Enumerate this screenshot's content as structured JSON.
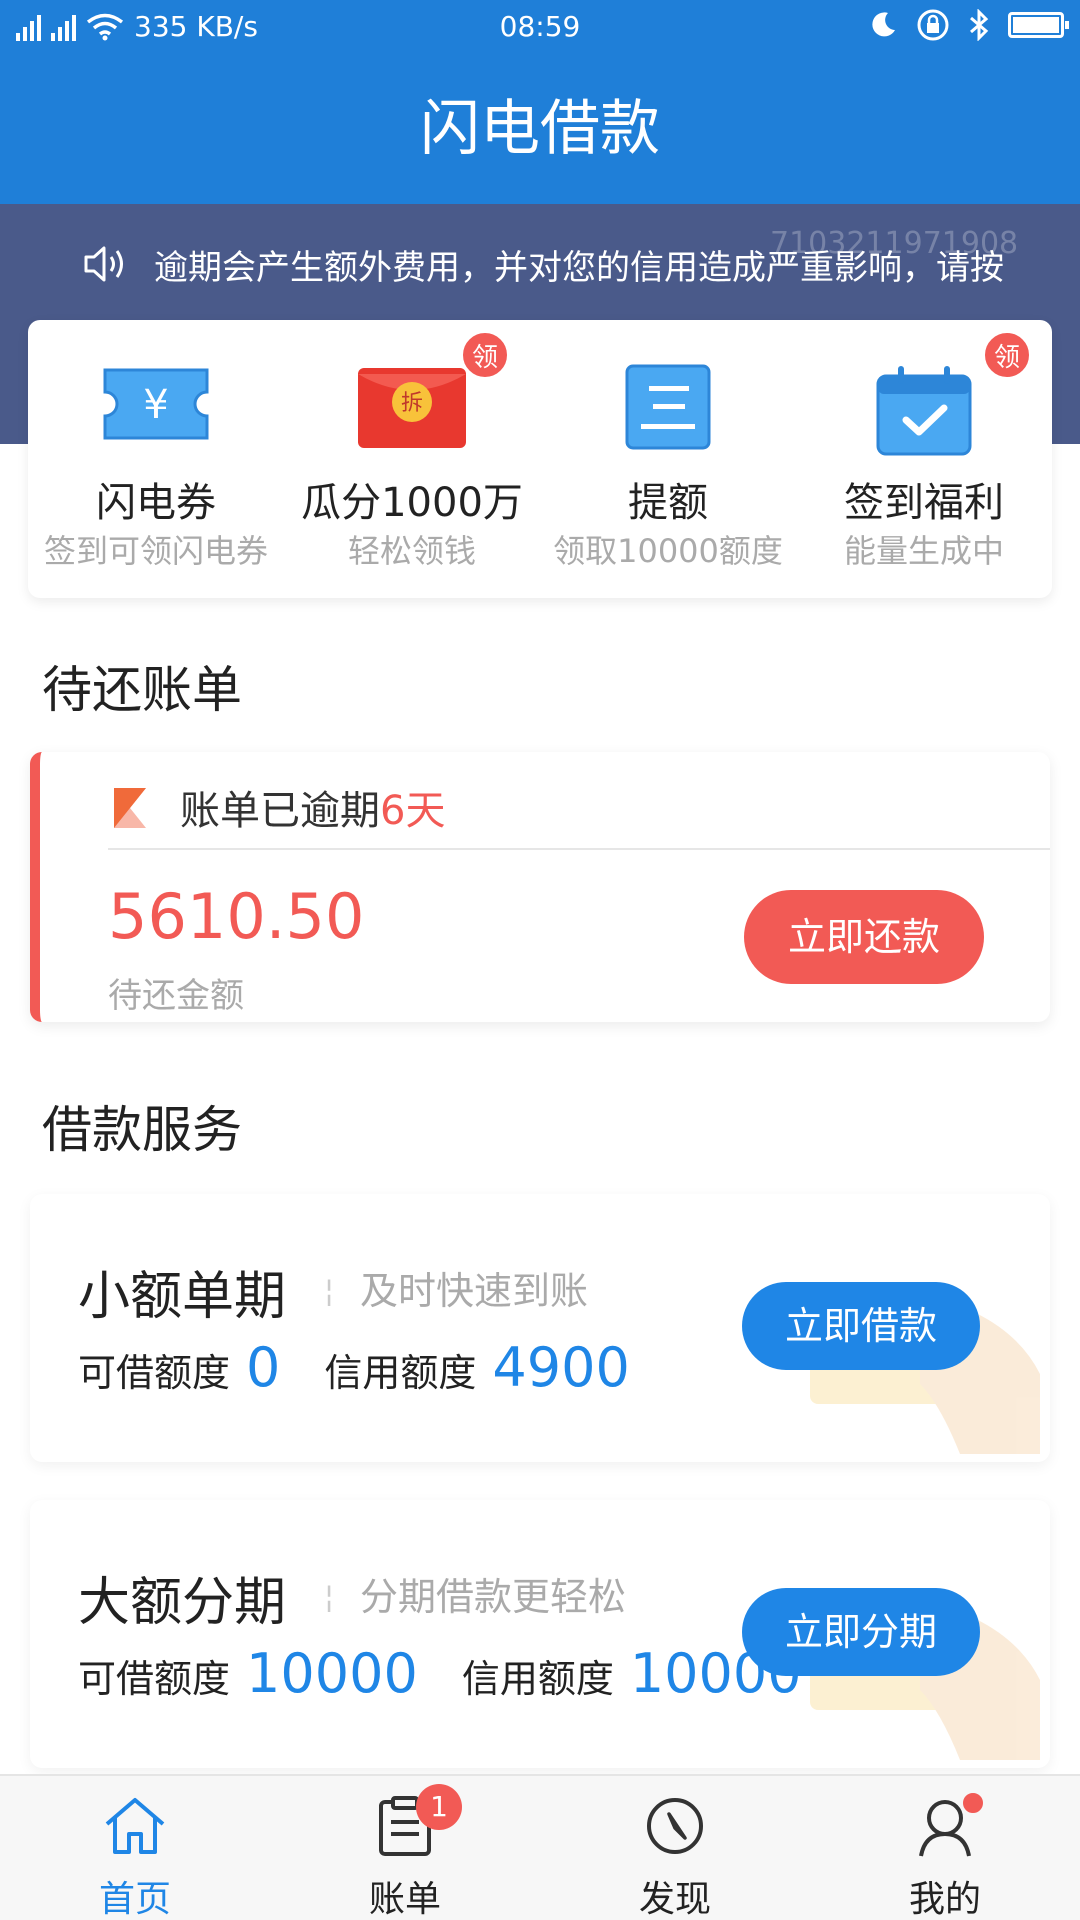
{
  "status_bar": {
    "net_type_1": "4G",
    "net_type_2": "3G",
    "speed": "335 KB/s",
    "time": "08:59"
  },
  "header": {
    "title": "闪电借款"
  },
  "notice": {
    "text": "逾期会产生额外费用，并对您的信用造成严重影响，请按",
    "watermark": "7103211971908"
  },
  "quick_actions": [
    {
      "label": "闪电券",
      "sub": "签到可领闪电券",
      "icon": "ticket-icon",
      "badge": ""
    },
    {
      "label": "瓜分1000万",
      "sub": "轻松领钱",
      "icon": "red-envelope-icon",
      "badge": "领",
      "envelope_text": "拆"
    },
    {
      "label": "提额",
      "sub": "领取10000额度",
      "icon": "document-icon",
      "badge": ""
    },
    {
      "label": "签到福利",
      "sub": "能量生成中",
      "icon": "calendar-check-icon",
      "badge": "领"
    }
  ],
  "bill_section": {
    "title": "待还账单",
    "status_prefix": "账单已逾期",
    "overdue_days": "6天",
    "amount": "5610.50",
    "amount_label": "待还金额",
    "pay_button": "立即还款"
  },
  "loan_section": {
    "title": "借款服务",
    "products": [
      {
        "name": "小额单期",
        "desc": "及时快速到账",
        "available_label": "可借额度",
        "available": "0",
        "credit_label": "信用额度",
        "credit": "4900",
        "button": "立即借款"
      },
      {
        "name": "大额分期",
        "desc": "分期借款更轻松",
        "available_label": "可借额度",
        "available": "10000",
        "credit_label": "信用额度",
        "credit": "10000",
        "button": "立即分期"
      }
    ]
  },
  "tab_bar": {
    "tabs": [
      {
        "label": "首页",
        "icon": "home-icon",
        "active": true
      },
      {
        "label": "账单",
        "icon": "bill-icon",
        "badge": "1"
      },
      {
        "label": "发现",
        "icon": "compass-icon"
      },
      {
        "label": "我的",
        "icon": "user-icon"
      }
    ]
  },
  "colors": {
    "primary": "#1f7fd8",
    "accent_blue": "#1f86e6",
    "danger": "#f25a55",
    "notice_bg": "#4a5a8a"
  }
}
